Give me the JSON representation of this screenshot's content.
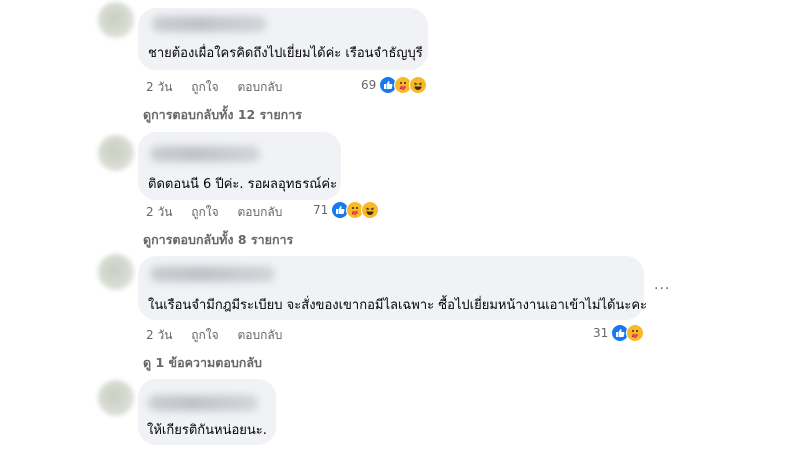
{
  "comments": [
    {
      "text": "ชายต้องเผื่อใครคิดถึงไปเยี่ยมได้ค่ะ เรือนจำธัญบุรี",
      "time": "2 วัน",
      "like_label": "ถูกใจ",
      "reply_label": "ตอบกลับ",
      "reaction_count": "69",
      "reactions": [
        "like-icon",
        "care-icon",
        "haha-icon"
      ],
      "view_replies": "ดูการตอบกลับทั้ง 12 รายการ"
    },
    {
      "text": "ติดตอนนี 6 ปีค่ะ. รอผลอุทธรณ์ค่ะ",
      "time": "2 วัน",
      "like_label": "ถูกใจ",
      "reply_label": "ตอบกลับ",
      "reaction_count": "71",
      "reactions": [
        "like-icon",
        "care-icon",
        "haha-icon"
      ],
      "view_replies": "ดูการตอบกลับทั้ง 8 รายการ"
    },
    {
      "text": "ในเรือนจำมีกฎมีระเบียบ จะสั่งของเขากอมีไลเฉพาะ ซื้อไปเยี่ยมหน้างานเอาเข้าไม่ได้นะคะ",
      "time": "2 วัน",
      "like_label": "ถูกใจ",
      "reply_label": "ตอบกลับ",
      "reaction_count": "31",
      "reactions": [
        "like-icon",
        "care-icon"
      ],
      "view_replies": "ดู 1 ข้อความตอบกลับ",
      "more_label": "..."
    },
    {
      "text": "ให้เกียรติกันหน่อยนะ."
    }
  ],
  "colors": {
    "bubble": "#f0f2f5",
    "meta": "#65676b",
    "like": "#1877f2",
    "emoji": "#f7b928"
  }
}
